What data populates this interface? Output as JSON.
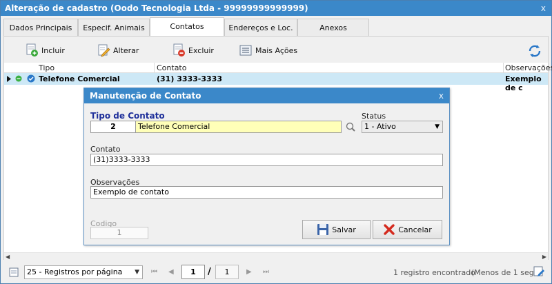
{
  "window": {
    "title": "Alteração de cadastro (Oodo Tecnologia Ltda - 99999999999999)",
    "close": "x"
  },
  "tabs": [
    {
      "label": "Dados Principais"
    },
    {
      "label": "Especif. Animais"
    },
    {
      "label": "Contatos"
    },
    {
      "label": "Endereços e Loc."
    },
    {
      "label": "Anexos"
    }
  ],
  "toolbar": {
    "include": "Incluir",
    "edit": "Alterar",
    "delete": "Excluir",
    "more": "Mais Ações"
  },
  "grid": {
    "columns": [
      "Tipo",
      "Contato",
      "Observações"
    ],
    "rows": [
      {
        "tipo": "Telefone Comercial",
        "contato": "(31) 3333-3333",
        "obs": "Exemplo de c"
      }
    ]
  },
  "modal": {
    "title": "Manutenção de Contato",
    "close": "x",
    "tipo_label": "Tipo de Contato",
    "tipo_code": "2",
    "tipo_name": "Telefone Comercial",
    "status_label": "Status",
    "status_value": "1 - Ativo",
    "contato_label": "Contato",
    "contato_value": "(31)3333-3333",
    "obs_label": "Observações",
    "obs_value": "Exemplo de contato",
    "codigo_label": "Codigo",
    "codigo_value": "1",
    "save": "Salvar",
    "cancel": "Cancelar"
  },
  "footer": {
    "page_size": "25 - Registros por página",
    "current_page": "1",
    "separator": "/",
    "total_pages": "1",
    "records": "1 registro encontrado",
    "time": "(Menos de 1 seg)"
  },
  "colors": {
    "titlebar": "#3b88c9",
    "selected_row": "#cde8f6",
    "highlight_field": "#ffffb8",
    "label_blue": "#1e2f9a"
  }
}
